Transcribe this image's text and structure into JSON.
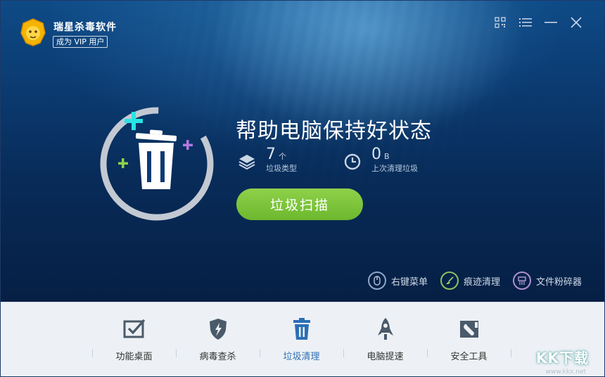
{
  "app": {
    "title": "瑞星杀毒软件",
    "vip_label": "成为 VIP 用户"
  },
  "titlebar": {
    "qr_icon": "qr-code-icon",
    "menu_icon": "menu-list-icon",
    "minimize_icon": "minimize-icon",
    "close_icon": "close-icon"
  },
  "status": {
    "headline": "帮助电脑保持好状态",
    "junk_types_value": "7",
    "junk_types_unit": "个",
    "junk_types_label": "垃圾类型",
    "last_cleaned_value": "0",
    "last_cleaned_unit": "B",
    "last_cleaned_label": "上次清理垃圾"
  },
  "scan_button": "垃圾扫描",
  "tools": [
    {
      "label": "右键菜单",
      "icon": "mouse-icon"
    },
    {
      "label": "痕迹清理",
      "icon": "broom-icon"
    },
    {
      "label": "文件粉碎器",
      "icon": "shredder-icon"
    }
  ],
  "nav": [
    {
      "label": "功能桌面",
      "icon": "checkbox-desktop-icon",
      "active": false
    },
    {
      "label": "病毒查杀",
      "icon": "shield-bolt-icon",
      "active": false
    },
    {
      "label": "垃圾清理",
      "icon": "trash-icon",
      "active": true
    },
    {
      "label": "电脑提速",
      "icon": "rocket-icon",
      "active": false
    },
    {
      "label": "安全工具",
      "icon": "wrench-box-icon",
      "active": false
    }
  ],
  "watermark": {
    "text": "KK下载",
    "url": "www.kkx.net"
  },
  "colors": {
    "accent_green": "#7cc43a",
    "active_nav": "#2c6fb5",
    "bg_deep": "#082b58"
  }
}
